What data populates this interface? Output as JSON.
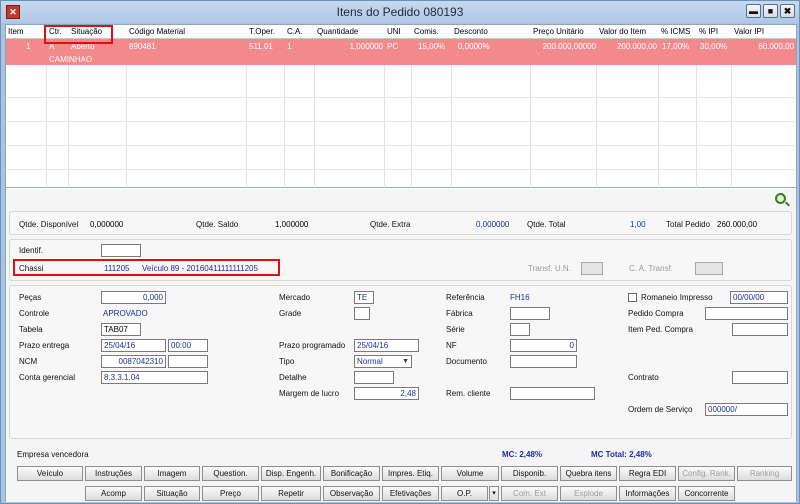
{
  "window": {
    "app_icon_glyph": "✕",
    "app_icon_name": "app-icon",
    "title": "Itens do Pedido 080193",
    "minimize_glyph": "▬",
    "maximize_glyph": "■",
    "close_glyph": "✖"
  },
  "grid": {
    "columns": [
      "Item",
      "Ctr.",
      "Situação",
      "Código Material",
      "T.Oper.",
      "C.A.",
      "Quantidade",
      "UNI",
      "Comis.",
      "Desconto",
      "Preço Unitário",
      "Valor do Item",
      "% ICMS",
      "% IPI",
      "Valor IPI"
    ],
    "row": {
      "item": "1",
      "ctr": "A",
      "situacao_line1": "Aberto",
      "situacao_line2": "CAMINHAO",
      "codigo": "890481",
      "toper": "511.01",
      "ca": "1",
      "quantidade": "1,000000",
      "uni": "PC",
      "comis": "15,00%",
      "desconto": "0,0000%",
      "preco_unitario": "200.000,00000",
      "valor_item": "200.000,00",
      "icms": "17,00%",
      "ipi": "30,00%",
      "valor_ipi": "60.000,00"
    },
    "row_color": "#f2898c",
    "highlight_color": "#e01010"
  },
  "totals": {
    "disponivel_label": "Qtde. Disponível",
    "disponivel_value": "0,000000",
    "saldo_label": "Qtde. Saldo",
    "saldo_value": "1,000000",
    "extra_label": "Qtde. Extra",
    "extra_value": "0,000000",
    "total_label": "Qtde. Total",
    "total_value": "1,00",
    "pedido_label": "Total Pedido",
    "pedido_value": "260.000,00"
  },
  "ident": {
    "identif_label": "Identif.",
    "identif_value": "",
    "chassi_label": "Chassi",
    "chassi_code": "111205",
    "chassi_desc": "Veículo 89 - 20160411111111205",
    "transf_un_label": "Transf. U.N.",
    "ca_transf_label": "C. A. Transf."
  },
  "details": {
    "pecas_label": "Peças",
    "pecas_value": "0,000",
    "controle_label": "Controle",
    "controle_value": "APROVADO",
    "tabela_label": "Tabela",
    "tabela_value": "TAB07",
    "prazo_entrega_label": "Prazo entrega",
    "prazo_entrega_date": "25/04/16",
    "prazo_entrega_time": "00:00",
    "ncm_label": "NCM",
    "ncm_value": "0087042310",
    "conta_label": "Conta gerencial",
    "conta_value": "8.3.3.1.04",
    "mercado_label": "Mercado",
    "mercado_value": "TE",
    "grade_label": "Grade",
    "prazo_prog_label": "Prazo programado",
    "prazo_prog_value": "25/04/16",
    "tipo_label": "Tipo",
    "tipo_value": "Normal",
    "detalhe_label": "Detalhe",
    "margem_label": "Margem de lucro",
    "margem_value": "2,48",
    "referencia_label": "Referência",
    "referencia_value": "FH16",
    "fabrica_label": "Fábrica",
    "serie_label": "Série",
    "nf_label": "NF",
    "nf_value": "0",
    "documento_label": "Documento",
    "rem_cliente_label": "Rem. cliente",
    "romaneio_label": "Romaneio Impresso",
    "romaneio_value": "00/00/00",
    "pedido_compra_label": "Pedido Compra",
    "item_ped_compra_label": "Item Ped. Compra",
    "contrato_label": "Contrato",
    "ordem_servico_label": "Ordem de Serviço",
    "ordem_servico_value": "000000/"
  },
  "footer": {
    "empresa_label": "Empresa vencedora",
    "mc_text": "MC: 2,48%",
    "mc_total_text": "MC Total: 2,48%"
  },
  "buttons_row1": [
    "Veículo",
    "Instruções",
    "Imagem",
    "Question.",
    "Disp. Engenh.",
    "Bonificação",
    "Impres. Etiq.",
    "Volume",
    "Disponib.",
    "Quebra itens",
    "Regra EDI",
    "Config. Rank.",
    "Ranking"
  ],
  "buttons_row2": [
    "Acomp",
    "Situação",
    "Preço",
    "Repetir",
    "Observação",
    "Efetivações",
    "O.P.",
    "▾",
    "Com. Ext",
    "Explode",
    "Informações",
    "Concorrente"
  ]
}
